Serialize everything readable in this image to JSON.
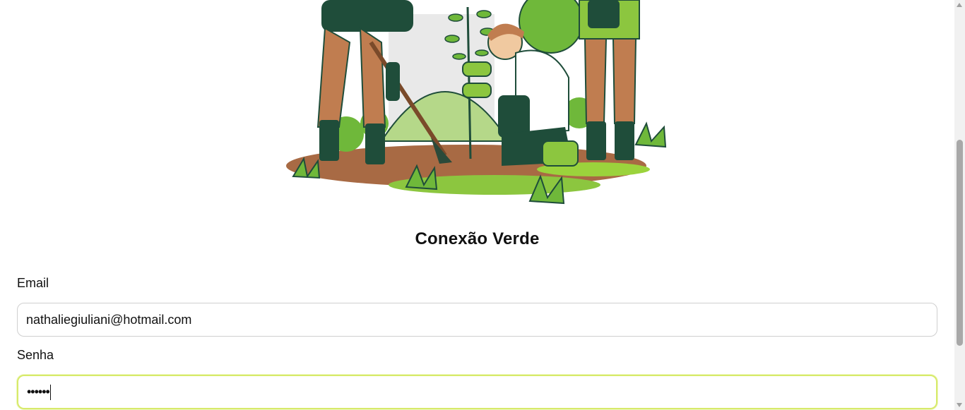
{
  "app": {
    "title": "Conexão Verde"
  },
  "illustration": {
    "icon": "tree-planting-illustration"
  },
  "form": {
    "email_label": "Email",
    "email_value": "nathaliegiuliani@hotmail.com",
    "password_label": "Senha",
    "password_mask": "••••••"
  },
  "colors": {
    "accent_focus": "#d7ea6a",
    "leaf_green": "#8cc63f",
    "dark_green": "#1f4d3a",
    "soil": "#9a5b3a"
  }
}
